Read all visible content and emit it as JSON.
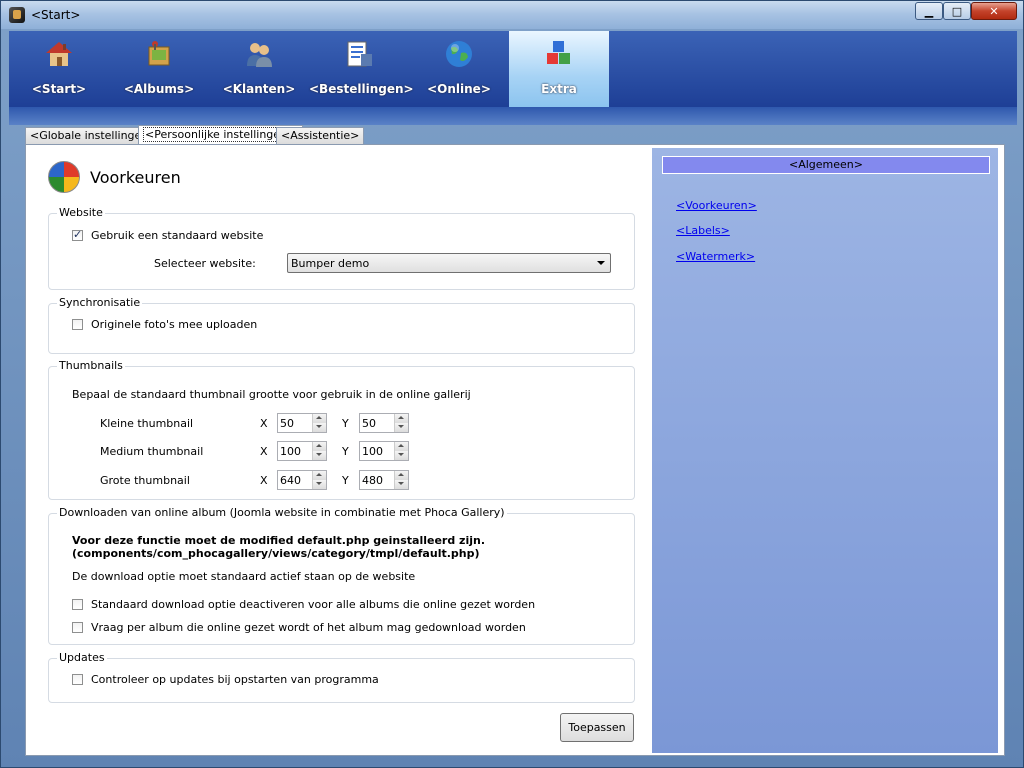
{
  "window": {
    "title": "<Start>",
    "buttons": {
      "minimize": "▁",
      "maximize": "□",
      "close": "✕"
    }
  },
  "nav": {
    "items": [
      {
        "label": "<Start>",
        "icon": "house-icon"
      },
      {
        "label": "<Albums>",
        "icon": "photo-album-icon"
      },
      {
        "label": "<Klanten>",
        "icon": "users-icon"
      },
      {
        "label": "<Bestellingen>",
        "icon": "orders-icon"
      },
      {
        "label": "<Online>",
        "icon": "globe-icon"
      },
      {
        "label": "Extra",
        "icon": "blocks-icon",
        "active": true
      }
    ]
  },
  "tabs": [
    {
      "label": "<Globale instellingen>"
    },
    {
      "label": "<Persoonlijke instellingen>",
      "active": true
    },
    {
      "label": "<Assistentie>"
    }
  ],
  "page": {
    "title": "Voorkeuren"
  },
  "website": {
    "legend": "Website",
    "use_default_label": "Gebruik een standaard website",
    "use_default_checked": true,
    "select_label": "Selecteer website:",
    "selected": "Bumper demo"
  },
  "sync": {
    "legend": "Synchronisatie",
    "upload_originals_label": "Originele foto's mee uploaden",
    "upload_originals_checked": false
  },
  "thumbnails": {
    "legend": "Thumbnails",
    "description": "Bepaal de standaard thumbnail grootte voor gebruik in de online gallerij",
    "x_label": "X",
    "y_label": "Y",
    "rows": [
      {
        "label": "Kleine thumbnail",
        "x": "50",
        "y": "50"
      },
      {
        "label": "Medium thumbnail",
        "x": "100",
        "y": "100"
      },
      {
        "label": "Grote thumbnail",
        "x": "640",
        "y": "480"
      }
    ]
  },
  "download": {
    "legend": "Downloaden van online album (Joomla website in combinatie met Phoca Gallery)",
    "warning_line1": "Voor deze functie moet de modified default.php geinstalleerd zijn.",
    "warning_line2": "(components/com_phocagallery/views/category/tmpl/default.php)",
    "note": "De download optie moet standaard actief staan op de website",
    "option1_label": "Standaard download optie deactiveren voor alle albums die online gezet worden",
    "option1_checked": false,
    "option2_label": "Vraag per album die online gezet wordt of het album mag gedownload worden",
    "option2_checked": false
  },
  "updates": {
    "legend": "Updates",
    "check_label": "Controleer op updates bij opstarten van programma",
    "check_checked": false
  },
  "apply_button": "Toepassen",
  "sidebar": {
    "header": "<Algemeen>",
    "links": [
      {
        "label": "<Voorkeuren>"
      },
      {
        "label": "<Labels>"
      },
      {
        "label": "<Watermerk>"
      }
    ]
  }
}
